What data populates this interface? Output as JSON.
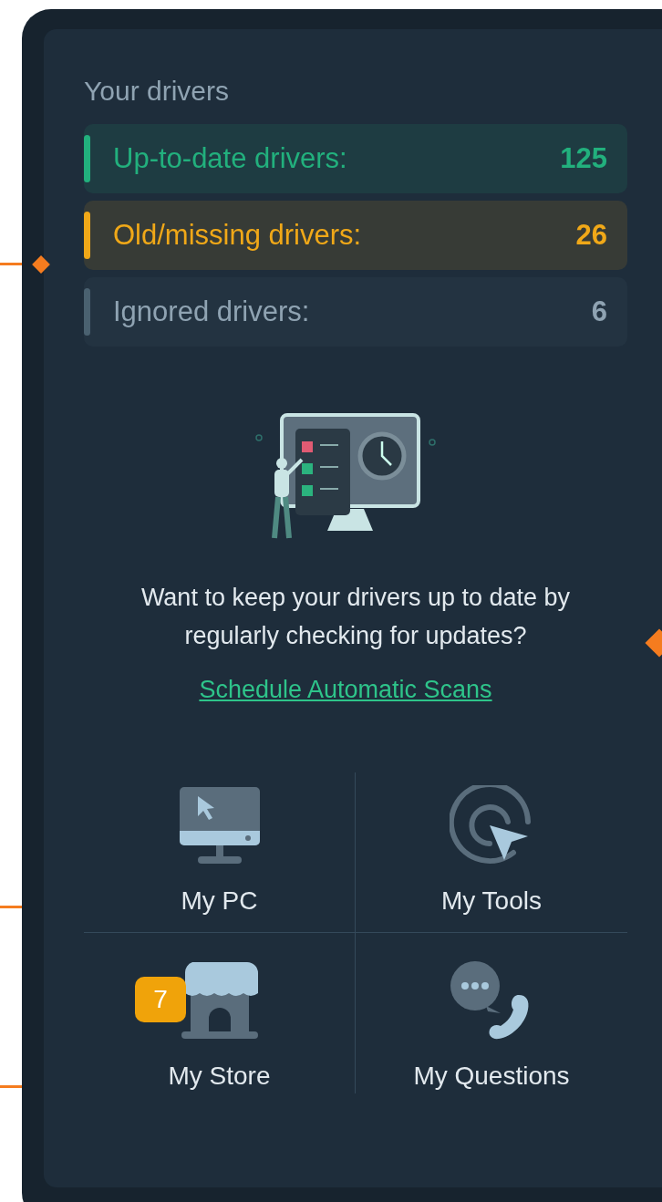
{
  "section_title": "Your drivers",
  "driver_counts": [
    {
      "label": "Up-to-date drivers:",
      "count": "125",
      "color": "#22b07d"
    },
    {
      "label": "Old/missing drivers:",
      "count": "26",
      "color": "#f0a818"
    },
    {
      "label": "Ignored drivers:",
      "count": "6",
      "color": "#4a6170"
    }
  ],
  "prompt": "Want to keep your drivers up to date by regularly checking for updates?",
  "link": "Schedule Automatic Scans",
  "tiles": [
    {
      "kind": "pc",
      "label": "My PC"
    },
    {
      "kind": "tools",
      "label": "My Tools"
    },
    {
      "kind": "store",
      "label": "My Store",
      "badge": "7"
    },
    {
      "kind": "questions",
      "label": "My Questions"
    }
  ]
}
